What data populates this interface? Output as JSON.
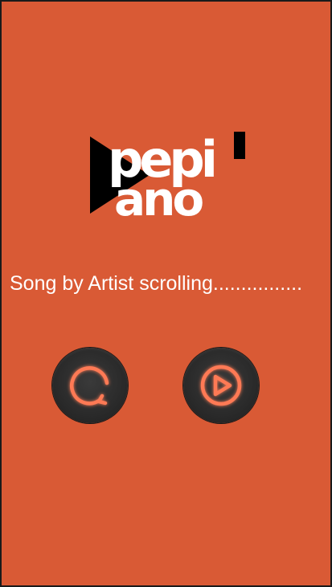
{
  "logo": {
    "line1": "pepi",
    "line2": "ano",
    "apostrophe": "'",
    "colors": {
      "text": "#ffffff",
      "mark": "#000000"
    }
  },
  "now_playing": {
    "text": "Song by Artist scrolling................"
  },
  "controls": {
    "replay_icon": "replay-icon",
    "play_icon": "play-icon",
    "glow_color": "#FF6A45"
  },
  "theme": {
    "background": "#D95A35",
    "frame": "#1a1a1a"
  }
}
